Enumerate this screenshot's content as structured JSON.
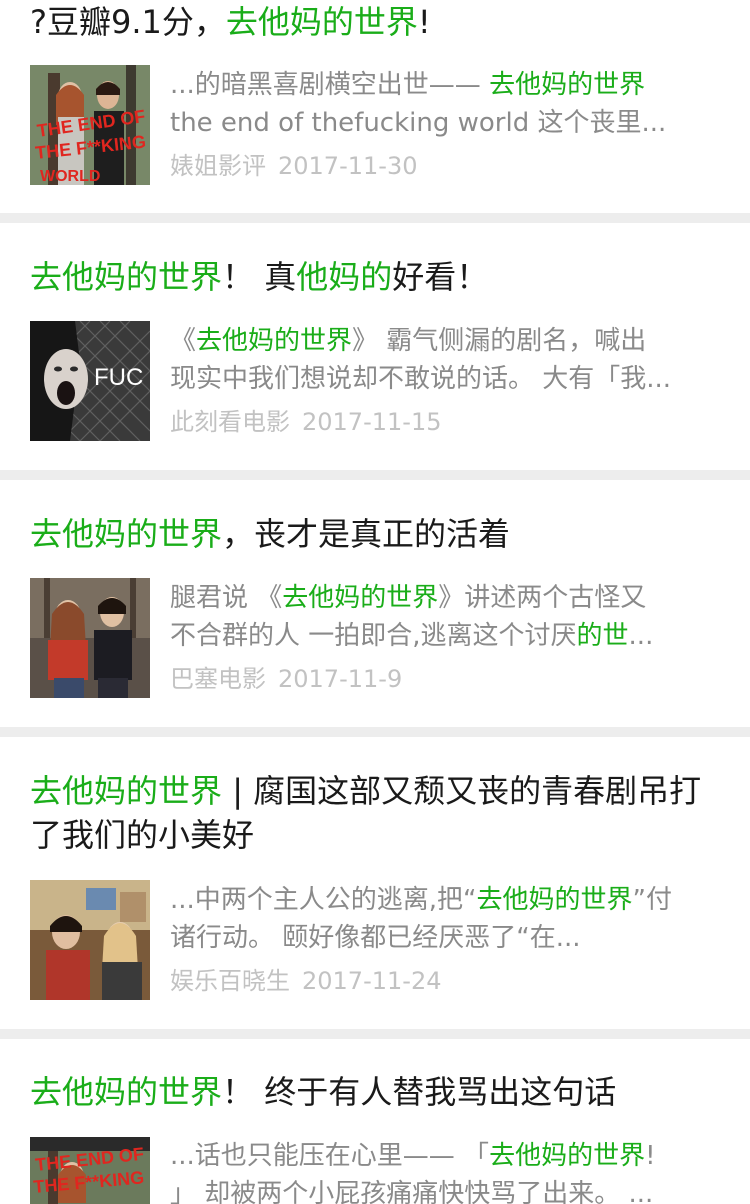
{
  "results": [
    {
      "title_parts": [
        {
          "text": "?豆瓣9.1分，",
          "hl": false
        },
        {
          "text": "去他妈的世界",
          "hl": true
        },
        {
          "text": "!",
          "hl": false
        }
      ],
      "snippet_lines": [
        [
          {
            "text": "...的暗黑喜剧横空出世—— ",
            "hl": false
          },
          {
            "text": "去他妈的世界",
            "hl": true
          }
        ],
        [
          {
            "text": "the end of thefucking world 这个丧里...",
            "hl": false
          }
        ]
      ],
      "source": "婊姐影评",
      "date": "2017-11-30",
      "thumb": {
        "icon": "poster-end-of-world-icon",
        "overlay_text": "THE END OF THE F**KING WORLD",
        "bg": "#6b7a5c"
      }
    },
    {
      "title_parts": [
        {
          "text": "去他妈的世界",
          "hl": true
        },
        {
          "text": "！ 真",
          "hl": false
        },
        {
          "text": "他妈的",
          "hl": true
        },
        {
          "text": "好看！",
          "hl": false
        }
      ],
      "snippet_lines": [
        [
          {
            "text": "《",
            "hl": false
          },
          {
            "text": "去他妈的世界",
            "hl": true
          },
          {
            "text": "》 霸气侧漏的剧名，喊出",
            "hl": false
          }
        ],
        [
          {
            "text": "现实中我们想说却不敢说的话。 大有「我...",
            "hl": false
          }
        ]
      ],
      "source": "此刻看电影",
      "date": "2017-11-15",
      "thumb": {
        "icon": "screaming-girl-fence-icon",
        "overlay_text": "FUC",
        "bg": "#3a3a3a"
      }
    },
    {
      "title_parts": [
        {
          "text": "去他妈的世界",
          "hl": true
        },
        {
          "text": "，丧才是真正的活着",
          "hl": false
        }
      ],
      "snippet_lines": [
        [
          {
            "text": "腿君说 《",
            "hl": false
          },
          {
            "text": "去他妈的世界",
            "hl": true
          },
          {
            "text": "》讲述两个古怪又",
            "hl": false
          }
        ],
        [
          {
            "text": "不合群的人 一拍即合,逃离这个讨厌",
            "hl": false
          },
          {
            "text": "的世",
            "hl": true
          },
          {
            "text": "...",
            "hl": false
          }
        ]
      ],
      "source": "巴塞电影",
      "date": "2017-11-9",
      "thumb": {
        "icon": "two-teens-sitting-icon",
        "overlay_text": "",
        "bg": "#5a5048"
      }
    },
    {
      "title_parts": [
        {
          "text": "去他妈的世界",
          "hl": true
        },
        {
          "text": " | 腐国这部又颓又丧的青春剧吊打了我们的小美好",
          "hl": false
        }
      ],
      "snippet_lines": [
        [
          {
            "text": "...中两个主人公的逃离,把“",
            "hl": false
          },
          {
            "text": "去他妈的世界",
            "hl": true
          },
          {
            "text": "”付",
            "hl": false
          }
        ],
        [
          {
            "text": "诸行动。 颐好像都已经厌恶了“在...",
            "hl": false
          }
        ]
      ],
      "source": "娱乐百晓生",
      "date": "2017-11-24",
      "thumb": {
        "icon": "two-teens-car-icon",
        "overlay_text": "",
        "bg": "#7a5a3a"
      }
    },
    {
      "title_parts": [
        {
          "text": "去他妈的世界",
          "hl": true
        },
        {
          "text": "！ 终于有人替我骂出这句话",
          "hl": false
        }
      ],
      "snippet_lines": [
        [
          {
            "text": "...话也只能压在心里—— 「",
            "hl": false
          },
          {
            "text": "去他妈的世界",
            "hl": true
          },
          {
            "text": "!",
            "hl": false
          }
        ],
        [
          {
            "text": "」 却被两个小屁孩痛痛快快骂了出来。 ...",
            "hl": false
          }
        ]
      ],
      "source": "",
      "date": "",
      "thumb": {
        "icon": "poster-end-of-world-icon",
        "overlay_text": "THE END OF THE F**KING",
        "bg": "#6b7a5c"
      }
    }
  ],
  "colors": {
    "highlight": "#1aad19",
    "title": "#1a1a1a",
    "snippet": "#8a8a8a",
    "meta": "#c2c2c2",
    "separator": "#ededed"
  }
}
